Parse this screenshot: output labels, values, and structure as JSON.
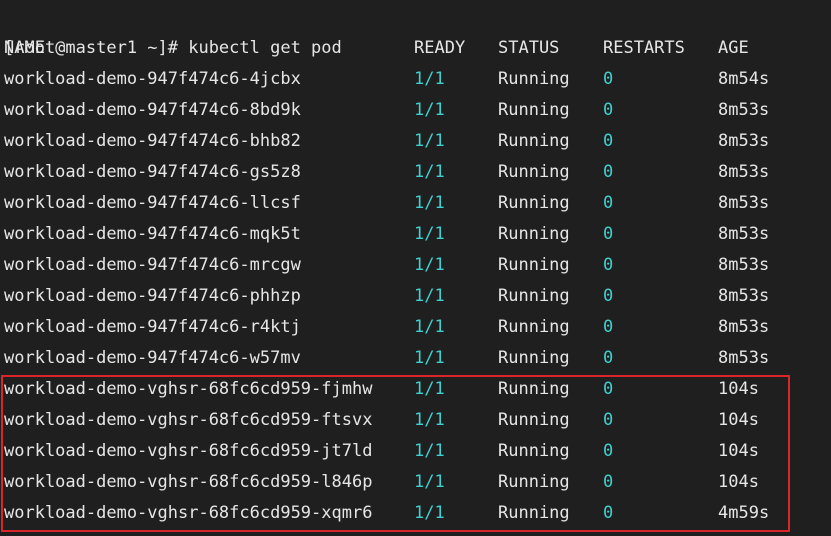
{
  "prompt": {
    "text": "[root@master1 ~]# kubectl get pod"
  },
  "table": {
    "headers": {
      "name": "NAME",
      "ready": "READY",
      "status": "STATUS",
      "restarts": "RESTARTS",
      "age": "AGE"
    },
    "rows": [
      {
        "name": "workload-demo-947f474c6-4jcbx",
        "ready": "1/1",
        "status": "Running",
        "restarts": "0",
        "age": "8m54s"
      },
      {
        "name": "workload-demo-947f474c6-8bd9k",
        "ready": "1/1",
        "status": "Running",
        "restarts": "0",
        "age": "8m53s"
      },
      {
        "name": "workload-demo-947f474c6-bhb82",
        "ready": "1/1",
        "status": "Running",
        "restarts": "0",
        "age": "8m53s"
      },
      {
        "name": "workload-demo-947f474c6-gs5z8",
        "ready": "1/1",
        "status": "Running",
        "restarts": "0",
        "age": "8m53s"
      },
      {
        "name": "workload-demo-947f474c6-llcsf",
        "ready": "1/1",
        "status": "Running",
        "restarts": "0",
        "age": "8m53s"
      },
      {
        "name": "workload-demo-947f474c6-mqk5t",
        "ready": "1/1",
        "status": "Running",
        "restarts": "0",
        "age": "8m53s"
      },
      {
        "name": "workload-demo-947f474c6-mrcgw",
        "ready": "1/1",
        "status": "Running",
        "restarts": "0",
        "age": "8m53s"
      },
      {
        "name": "workload-demo-947f474c6-phhzp",
        "ready": "1/1",
        "status": "Running",
        "restarts": "0",
        "age": "8m53s"
      },
      {
        "name": "workload-demo-947f474c6-r4ktj",
        "ready": "1/1",
        "status": "Running",
        "restarts": "0",
        "age": "8m53s"
      },
      {
        "name": "workload-demo-947f474c6-w57mv",
        "ready": "1/1",
        "status": "Running",
        "restarts": "0",
        "age": "8m53s"
      },
      {
        "name": "workload-demo-vghsr-68fc6cd959-fjmhw",
        "ready": "1/1",
        "status": "Running",
        "restarts": "0",
        "age": "104s"
      },
      {
        "name": "workload-demo-vghsr-68fc6cd959-ftsvx",
        "ready": "1/1",
        "status": "Running",
        "restarts": "0",
        "age": "104s"
      },
      {
        "name": "workload-demo-vghsr-68fc6cd959-jt7ld",
        "ready": "1/1",
        "status": "Running",
        "restarts": "0",
        "age": "104s"
      },
      {
        "name": "workload-demo-vghsr-68fc6cd959-l846p",
        "ready": "1/1",
        "status": "Running",
        "restarts": "0",
        "age": "104s"
      },
      {
        "name": "workload-demo-vghsr-68fc6cd959-xqmr6",
        "ready": "1/1",
        "status": "Running",
        "restarts": "0",
        "age": "4m59s"
      }
    ]
  },
  "colors": {
    "background": "#1f1f1f",
    "foreground": "#e6e6e6",
    "accent_cyan": "#3fd0d0",
    "highlight_border": "#d9262b"
  }
}
